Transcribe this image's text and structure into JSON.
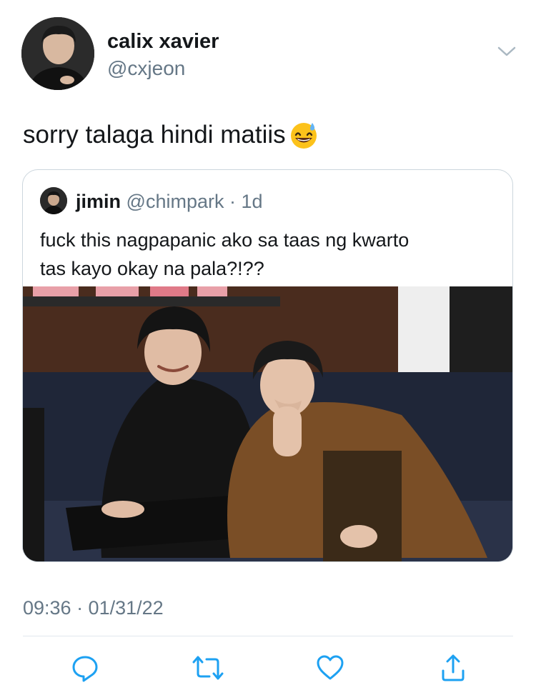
{
  "author": {
    "display_name": "calix xavier",
    "handle": "@cxjeon",
    "avatar_icon": "profile-photo"
  },
  "tweet": {
    "text": "sorry talaga hindi matiis",
    "emoji": "😅",
    "timestamp": "09:36 · 01/31/22"
  },
  "quoted_tweet": {
    "display_name": "jimin",
    "handle": "@chimpark",
    "age": "· 1d",
    "text_line1": "fuck this nagpapanic ako sa taas ng kwarto",
    "text_line2": "tas kayo okay na pala?!??",
    "media_icon": "photo"
  },
  "actions": {
    "reply_icon": "reply-icon",
    "retweet_icon": "retweet-icon",
    "like_icon": "heart-icon",
    "share_icon": "share-icon"
  },
  "colors": {
    "secondary_text": "#657786",
    "border": "#ccd6dd",
    "action_icon": "#1da1f2"
  }
}
